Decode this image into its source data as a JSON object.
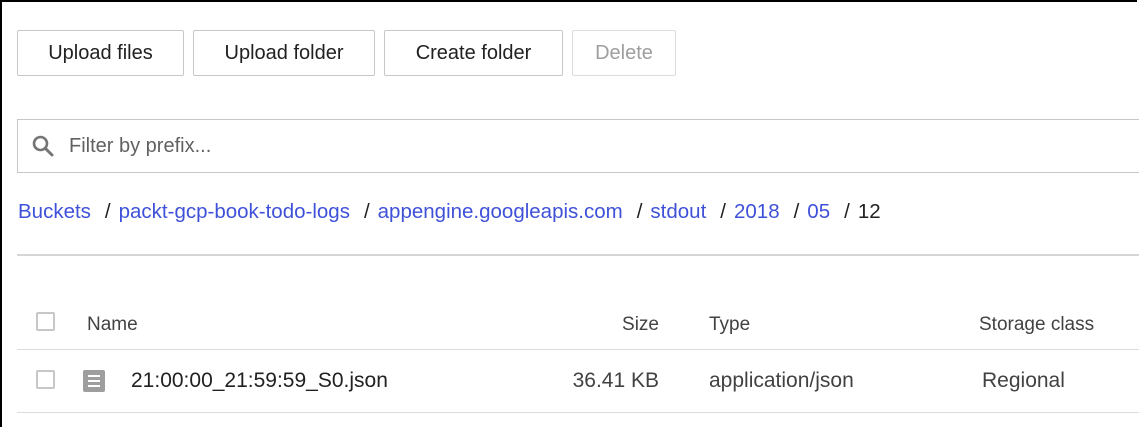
{
  "toolbar": {
    "upload_files_label": "Upload files",
    "upload_folder_label": "Upload folder",
    "create_folder_label": "Create folder",
    "delete_label": "Delete",
    "delete_disabled": true
  },
  "filter": {
    "placeholder": "Filter by prefix...",
    "icon": "search-icon"
  },
  "breadcrumb": {
    "items": [
      {
        "label": "Buckets",
        "link": true
      },
      {
        "label": "packt-gcp-book-todo-logs",
        "link": true
      },
      {
        "label": "appengine.googleapis.com",
        "link": true
      },
      {
        "label": "stdout",
        "link": true
      },
      {
        "label": "2018",
        "link": true
      },
      {
        "label": "05",
        "link": true
      },
      {
        "label": "12",
        "link": false
      }
    ],
    "separator": "/"
  },
  "table": {
    "columns": {
      "name": "Name",
      "size": "Size",
      "type": "Type",
      "storage_class": "Storage class"
    },
    "rows": [
      {
        "name": "21:00:00_21:59:59_S0.json",
        "size": "36.41 KB",
        "type": "application/json",
        "storage_class": "Regional",
        "icon": "file-icon"
      }
    ]
  },
  "colors": {
    "link": "#3f51d8",
    "border": "#c7c7c7",
    "disabled_text": "#9e9e9e",
    "file_icon": "#9e9e9e"
  }
}
